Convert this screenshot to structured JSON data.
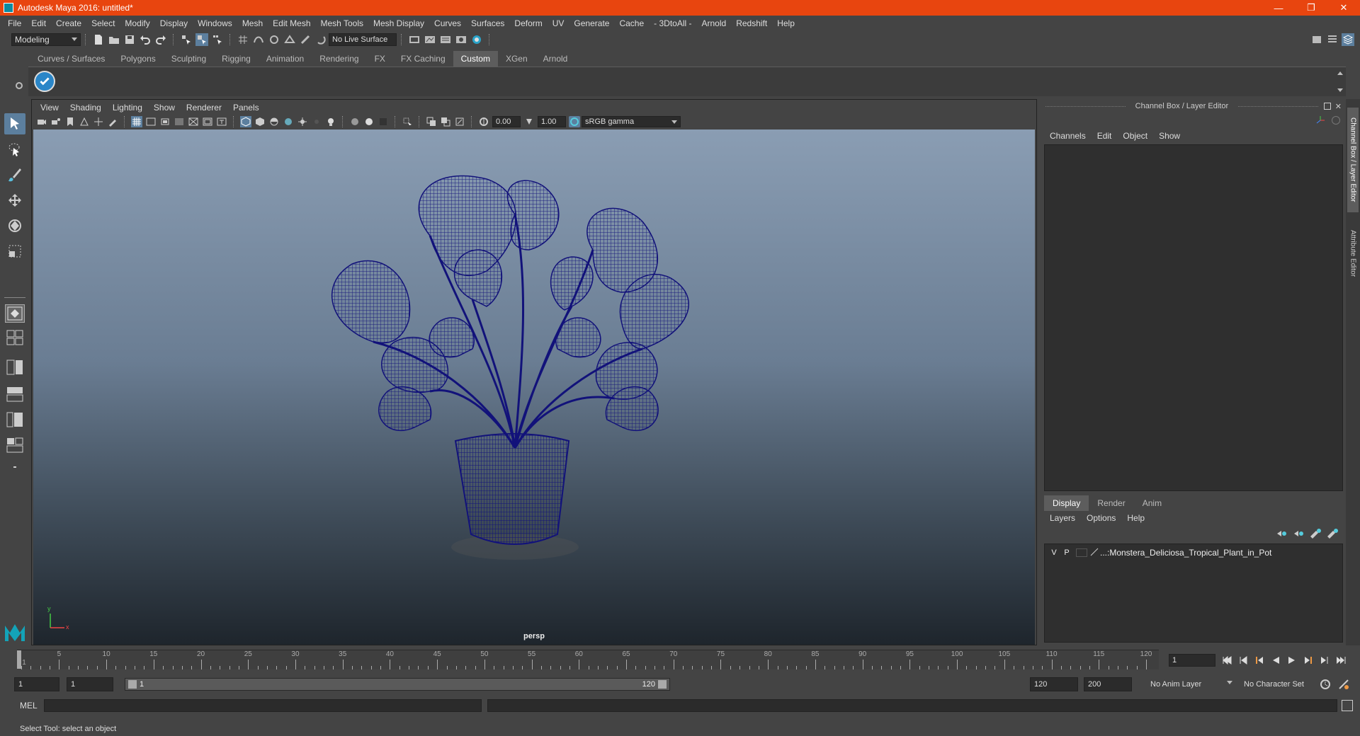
{
  "window": {
    "title": "Autodesk Maya 2016: untitled*",
    "minimize": "—",
    "maximize": "❐",
    "close": "✕"
  },
  "menubar": [
    "File",
    "Edit",
    "Create",
    "Select",
    "Modify",
    "Display",
    "Windows",
    "Mesh",
    "Edit Mesh",
    "Mesh Tools",
    "Mesh Display",
    "Curves",
    "Surfaces",
    "Deform",
    "UV",
    "Generate",
    "Cache",
    "- 3DtoAll -",
    "Arnold",
    "Redshift",
    "Help"
  ],
  "statusline": {
    "mode": "Modeling",
    "live_surface": "No Live Surface"
  },
  "shelf": {
    "tabs": [
      "Curves / Surfaces",
      "Polygons",
      "Sculpting",
      "Rigging",
      "Animation",
      "Rendering",
      "FX",
      "FX Caching",
      "Custom",
      "XGen",
      "Arnold"
    ],
    "active_tab": "Custom"
  },
  "viewport": {
    "menu": [
      "View",
      "Shading",
      "Lighting",
      "Show",
      "Renderer",
      "Panels"
    ],
    "exposure": "0.00",
    "gamma": "1.00",
    "color_space": "sRGB gamma",
    "camera": "persp",
    "axis_y": "y",
    "axis_x": "x"
  },
  "channel_box": {
    "title": "Channel Box / Layer Editor",
    "menu": [
      "Channels",
      "Edit",
      "Object",
      "Show"
    ],
    "layer_tabs": [
      "Display",
      "Render",
      "Anim"
    ],
    "active_layer_tab": "Display",
    "layer_menu": [
      "Layers",
      "Options",
      "Help"
    ],
    "layers": [
      {
        "v": "V",
        "p": "P",
        "name": "...:Monstera_Deliciosa_Tropical_Plant_in_Pot"
      }
    ],
    "side_tabs": [
      "Channel Box / Layer Editor",
      "Attribute Editor"
    ]
  },
  "timeline": {
    "ticks": [
      1,
      5,
      10,
      15,
      20,
      25,
      30,
      35,
      40,
      45,
      50,
      55,
      60,
      65,
      70,
      75,
      80,
      85,
      90,
      95,
      100,
      105,
      110,
      115,
      120
    ],
    "start": 1,
    "end": 120,
    "current_frame": "1"
  },
  "range": {
    "start_time": "1",
    "playback_start": "1",
    "range_min": "1",
    "range_max": "120",
    "playback_end": "120",
    "end_time": "200",
    "anim_layer": "No Anim Layer",
    "character_set": "No Character Set"
  },
  "cmdline": {
    "label": "MEL"
  },
  "helpline": {
    "message": "Select Tool: select an object"
  },
  "colors": {
    "title_bar": "#e8450f",
    "wireframe": "#12127a",
    "active_tool": "#5c7f9e"
  }
}
